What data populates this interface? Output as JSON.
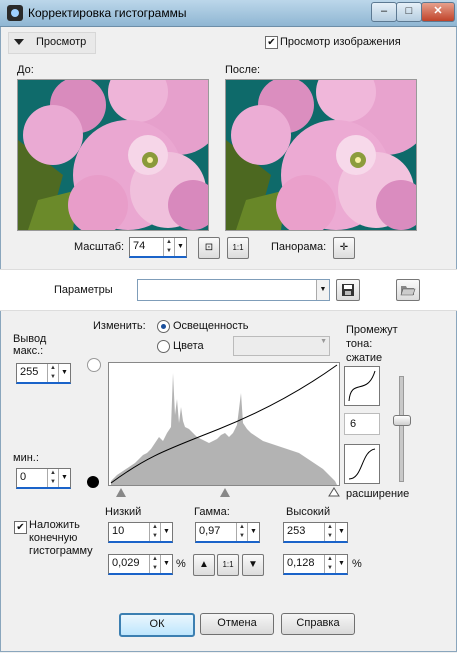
{
  "window": {
    "title": "Корректировка гистограммы",
    "close_glyph": "✕",
    "min_glyph": "–",
    "max_glyph": "□"
  },
  "preview": {
    "toggle_label": "Просмотр",
    "show_image_label": "Просмотр изображения",
    "show_image_checked": true,
    "before_label": "До:",
    "after_label": "После:"
  },
  "scale": {
    "label": "Масштаб:",
    "value": "74",
    "fit_glyph": "⊡",
    "actual_glyph": "1:1",
    "pan_label": "Панорама:",
    "pan_glyph": "✛"
  },
  "parameters": {
    "label": "Параметры",
    "value": ""
  },
  "output": {
    "max_label": "Вывод макс.:",
    "max_value": "255",
    "min_label": "мин.:",
    "min_value": "0"
  },
  "change": {
    "label": "Изменить:",
    "options": [
      "Освещенность",
      "Цвета"
    ],
    "selected": "Освещенность",
    "channel_value": ""
  },
  "tone": {
    "label": "Промежут тона:",
    "compress_label": "сжатие",
    "value": "6",
    "expand_label": "расширение",
    "slider_level": 0.5
  },
  "levels": {
    "low_label": "Низкий",
    "low_value": "10",
    "low_percent": "0,029",
    "gamma_label": "Гамма:",
    "gamma_value": "0,97",
    "high_label": "Высокий",
    "high_value": "253",
    "high_percent": "0,128",
    "percent_sign": "%",
    "up_glyph": "▲",
    "oneone_glyph": "1:1",
    "down_glyph": "▼"
  },
  "overlay": {
    "label": "Наложить конечную гистограмму",
    "checked": true
  },
  "buttons": {
    "ok": "ОК",
    "cancel": "Отмена",
    "help": "Справка"
  },
  "colors": {
    "accent": "#1a63c9",
    "histogram_fill": "#b3b3b3",
    "petal": "#e9a6cf",
    "background_teal": "#0f6b6b"
  }
}
